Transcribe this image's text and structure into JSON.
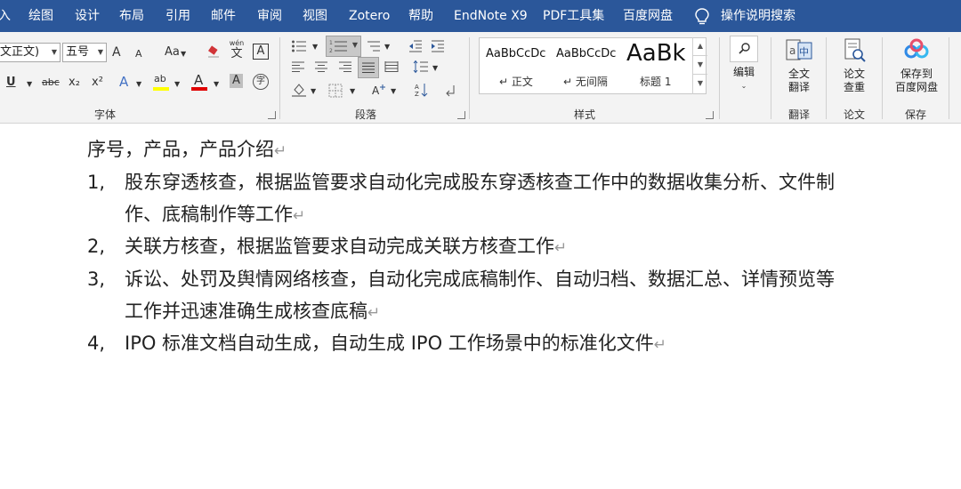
{
  "menu": {
    "partial": "入",
    "tabs": [
      "绘图",
      "设计",
      "布局",
      "引用",
      "邮件",
      "审阅",
      "视图",
      "Zotero",
      "帮助",
      "EndNote X9",
      "PDF工具集",
      "百度网盘"
    ],
    "search": "操作说明搜索"
  },
  "font_group": {
    "font_name": "文正文)",
    "font_size": "五号",
    "grow": "A",
    "shrink": "A",
    "case": "Aa",
    "wen": "wén",
    "wen_char": "文",
    "border_char": "A",
    "underline": "U",
    "strike": "abc",
    "sub": "x₂",
    "sup": "x²",
    "effects": "A",
    "highlight": "ab",
    "color_a": "A",
    "shade_a": "A",
    "enclose": "字",
    "label": "字体",
    "colors": {
      "highlight": "#ffff00",
      "font": "#e00000"
    }
  },
  "para_group": {
    "label": "段落"
  },
  "styles_group": {
    "label": "样式",
    "items": [
      {
        "preview": "AaBbCcDc",
        "name": "↵ 正文"
      },
      {
        "preview": "AaBbCcDc",
        "name": "↵ 无间隔"
      },
      {
        "preview": "AaBk",
        "name": "标题 1"
      }
    ]
  },
  "edit_group": {
    "label": "编辑"
  },
  "translate_group": {
    "btn_line1": "全文",
    "btn_line2": "翻译",
    "label": "翻译",
    "icon_a": "a",
    "icon_zh": "中"
  },
  "thesis_group": {
    "btn_line1": "论文",
    "btn_line2": "查重",
    "label": "论文"
  },
  "save_group": {
    "btn_line1": "保存到",
    "btn_line2": "百度网盘",
    "label": "保存"
  },
  "document": {
    "mark": "↵",
    "heading": "序号，产品，产品介绍",
    "items": [
      {
        "num": "1,",
        "line1": "股东穿透核查，根据监管要求自动化完成股东穿透核查工作中的数据收集分析、文件制",
        "line2": "作、底稿制作等工作"
      },
      {
        "num": "2,",
        "line1": "关联方核查，根据监管要求自动完成关联方核查工作"
      },
      {
        "num": "3,",
        "line1": "诉讼、处罚及舆情网络核查，自动化完成底稿制作、自动归档、数据汇总、详情预览等",
        "line2": "工作并迅速准确生成核查底稿"
      },
      {
        "num": "4,",
        "line1": "IPO 标准文档自动生成，自动生成 IPO 工作场景中的标准化文件"
      }
    ]
  }
}
